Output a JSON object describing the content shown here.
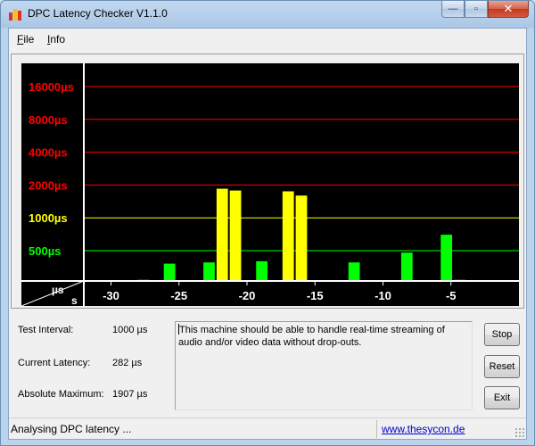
{
  "window": {
    "title": "DPC Latency Checker V1.1.0",
    "controls": {
      "minimize": "—",
      "maximize": "▫",
      "close": "✕"
    }
  },
  "menu": [
    {
      "label": "File",
      "mnemonic": "F",
      "rest": "ile"
    },
    {
      "label": "Info",
      "mnemonic": "I",
      "rest": "nfo"
    }
  ],
  "chart_data": {
    "type": "bar",
    "y_scale": "log2 (display)",
    "y_levels": [
      {
        "label": "16000µs",
        "value": 16000,
        "color": "#ff0000"
      },
      {
        "label": "8000µs",
        "value": 8000,
        "color": "#ff0000"
      },
      {
        "label": "4000µs",
        "value": 4000,
        "color": "#ff0000"
      },
      {
        "label": "2000µs",
        "value": 2000,
        "color": "#ff0000"
      },
      {
        "label": "1000µs",
        "value": 1000,
        "color": "#ffff00"
      },
      {
        "label": "500µs",
        "value": 500,
        "color": "#00ff00"
      }
    ],
    "x_ticks": [
      {
        "label": "-30",
        "value": -30
      },
      {
        "label": "-25",
        "value": -25
      },
      {
        "label": "-20",
        "value": -20
      },
      {
        "label": "-15",
        "value": -15
      },
      {
        "label": "-10",
        "value": -10
      },
      {
        "label": "-5",
        "value": -5
      }
    ],
    "corner_labels": {
      "y_unit": "µs",
      "x_unit": "s"
    },
    "x_range": [
      -32,
      0
    ],
    "background": "#000000",
    "bar_colors": {
      "ok": "#00ff00",
      "warning": "#ffff00"
    },
    "values": [
      180,
      180,
      250,
      240,
      270,
      180,
      380,
      190,
      180,
      390,
      1850,
      1780,
      230,
      400,
      180,
      1750,
      1600,
      250,
      200,
      230,
      390,
      180,
      240,
      180,
      480,
      200,
      210,
      700,
      270,
      210,
      200,
      170,
      230
    ]
  },
  "info": {
    "test_interval_label": "Test Interval:",
    "test_interval_value": "1000 µs",
    "current_latency_label": "Current Latency:",
    "current_latency_value": "282 µs",
    "absolute_maximum_label": "Absolute Maximum:",
    "absolute_maximum_value": "1907 µs"
  },
  "message": "This machine should be able to handle real-time streaming of audio and/or video data without drop-outs.",
  "buttons": {
    "stop": "Stop",
    "reset": "Reset",
    "exit": "Exit"
  },
  "status": {
    "text": "Analysing DPC latency ...",
    "link": "www.thesycon.de"
  }
}
